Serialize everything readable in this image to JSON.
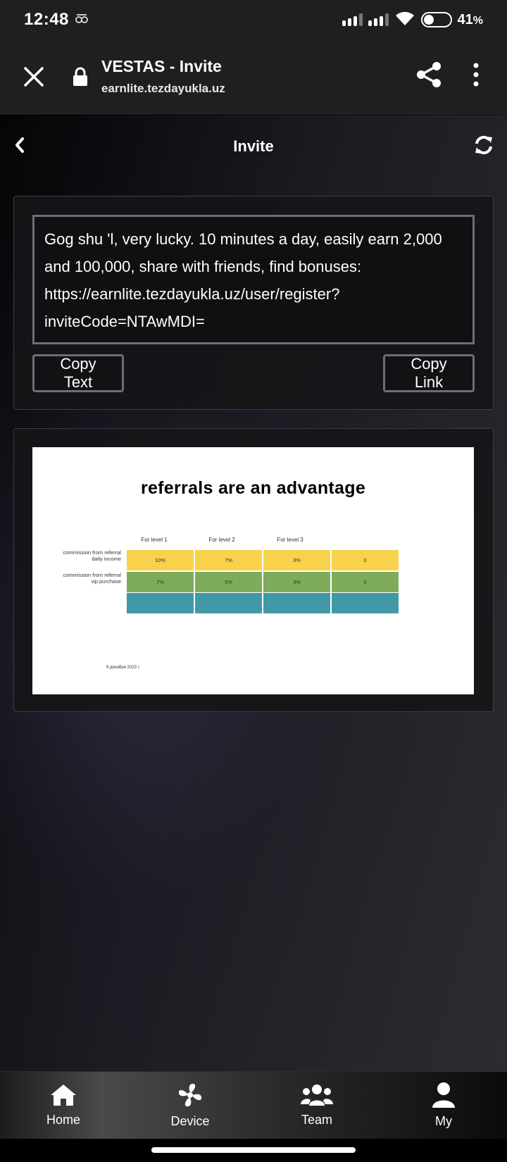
{
  "status_bar": {
    "time": "12:48",
    "battery_percent": "41",
    "battery_unit": "%",
    "battery_level": 0.41
  },
  "browser": {
    "title": "VESTAS - Invite",
    "url": "earnlite.tezdayukla.uz"
  },
  "header": {
    "title": "Invite"
  },
  "invite": {
    "message": "Gog shu 'l, very lucky. 10 minutes a day, easily earn 2,000 and 100,000, share with friends, find bonuses: https://earnlite.tezdayukla.uz/user/register?inviteCode=NTAwMDI=",
    "copy_text_label": "Copy Text",
    "copy_link_label": "Copy Link"
  },
  "promo": {
    "title": "referrals are an advantage",
    "levels": [
      "For level 1",
      "For level 2",
      "For level 3"
    ],
    "rows": [
      {
        "label": "commission from referral daily income",
        "values": [
          "10%",
          "7%",
          "3%",
          "0"
        ]
      },
      {
        "label": "commission from referral vip purchase",
        "values": [
          "7%",
          "5%",
          "3%",
          "0"
        ]
      },
      {
        "label": "",
        "values": [
          "",
          "",
          "",
          ""
        ]
      }
    ],
    "row_colors": [
      "#f8d24a",
      "#7fac5a",
      "#4198a6"
    ],
    "date": "9 декабря 2023 г."
  },
  "nav": [
    {
      "label": "Home",
      "icon": "home-icon"
    },
    {
      "label": "Device",
      "icon": "fan-icon"
    },
    {
      "label": "Team",
      "icon": "team-icon"
    },
    {
      "label": "My",
      "icon": "user-icon"
    }
  ],
  "colors": {
    "accent_border": "#6b6f75",
    "background": "#0c0c0e"
  }
}
